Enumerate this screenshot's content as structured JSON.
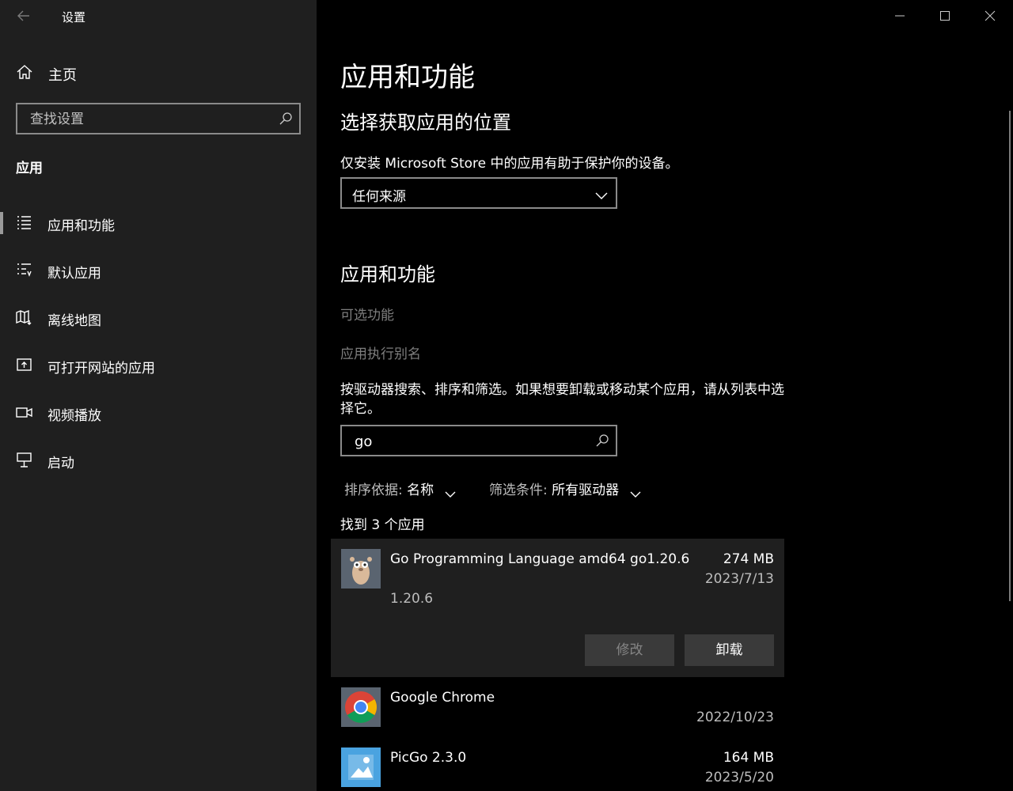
{
  "window": {
    "title": "设置"
  },
  "sidebar": {
    "home_label": "主页",
    "search_placeholder": "查找设置",
    "section_header": "应用",
    "items": [
      {
        "label": "应用和功能",
        "icon": "apps-features-icon",
        "selected": true
      },
      {
        "label": "默认应用",
        "icon": "default-apps-icon",
        "selected": false
      },
      {
        "label": "离线地图",
        "icon": "offline-maps-icon",
        "selected": false
      },
      {
        "label": "可打开网站的应用",
        "icon": "apps-for-websites-icon",
        "selected": false
      },
      {
        "label": "视频播放",
        "icon": "video-playback-icon",
        "selected": false
      },
      {
        "label": "启动",
        "icon": "startup-icon",
        "selected": false
      }
    ]
  },
  "main": {
    "title": "应用和功能",
    "source_section": {
      "title": "选择获取应用的位置",
      "description": "仅安装 Microsoft Store 中的应用有助于保护你的设备。",
      "dropdown_value": "任何来源"
    },
    "apps_section": {
      "title": "应用和功能",
      "optional_features_link": "可选功能",
      "aliases_link": "应用执行别名",
      "description": "按驱动器搜索、排序和筛选。如果想要卸载或移动某个应用，请从列表中选择它。",
      "search_value": "go",
      "sort_key": "排序依据:",
      "sort_value": "名称",
      "filter_key": "筛选条件:",
      "filter_value": "所有驱动器",
      "count_text": "找到 3 个应用"
    },
    "apps": [
      {
        "name": "Go Programming Language amd64 go1.20.6",
        "size": "274 MB",
        "date": "2023/7/13",
        "version": "1.20.6",
        "modify_label": "修改",
        "uninstall_label": "卸载",
        "icon": "go-gopher-icon"
      },
      {
        "name": "Google Chrome",
        "size": "",
        "date": "2022/10/23",
        "icon": "chrome-icon"
      },
      {
        "name": "PicGo 2.3.0",
        "size": "164 MB",
        "date": "2023/5/20",
        "icon": "picgo-icon"
      }
    ]
  },
  "colors": {
    "sidebar_bg": "#1f1f1f",
    "main_bg": "#000000",
    "selected_row_bg": "#1f1f1f",
    "disabled_text": "#7e7e7e"
  }
}
